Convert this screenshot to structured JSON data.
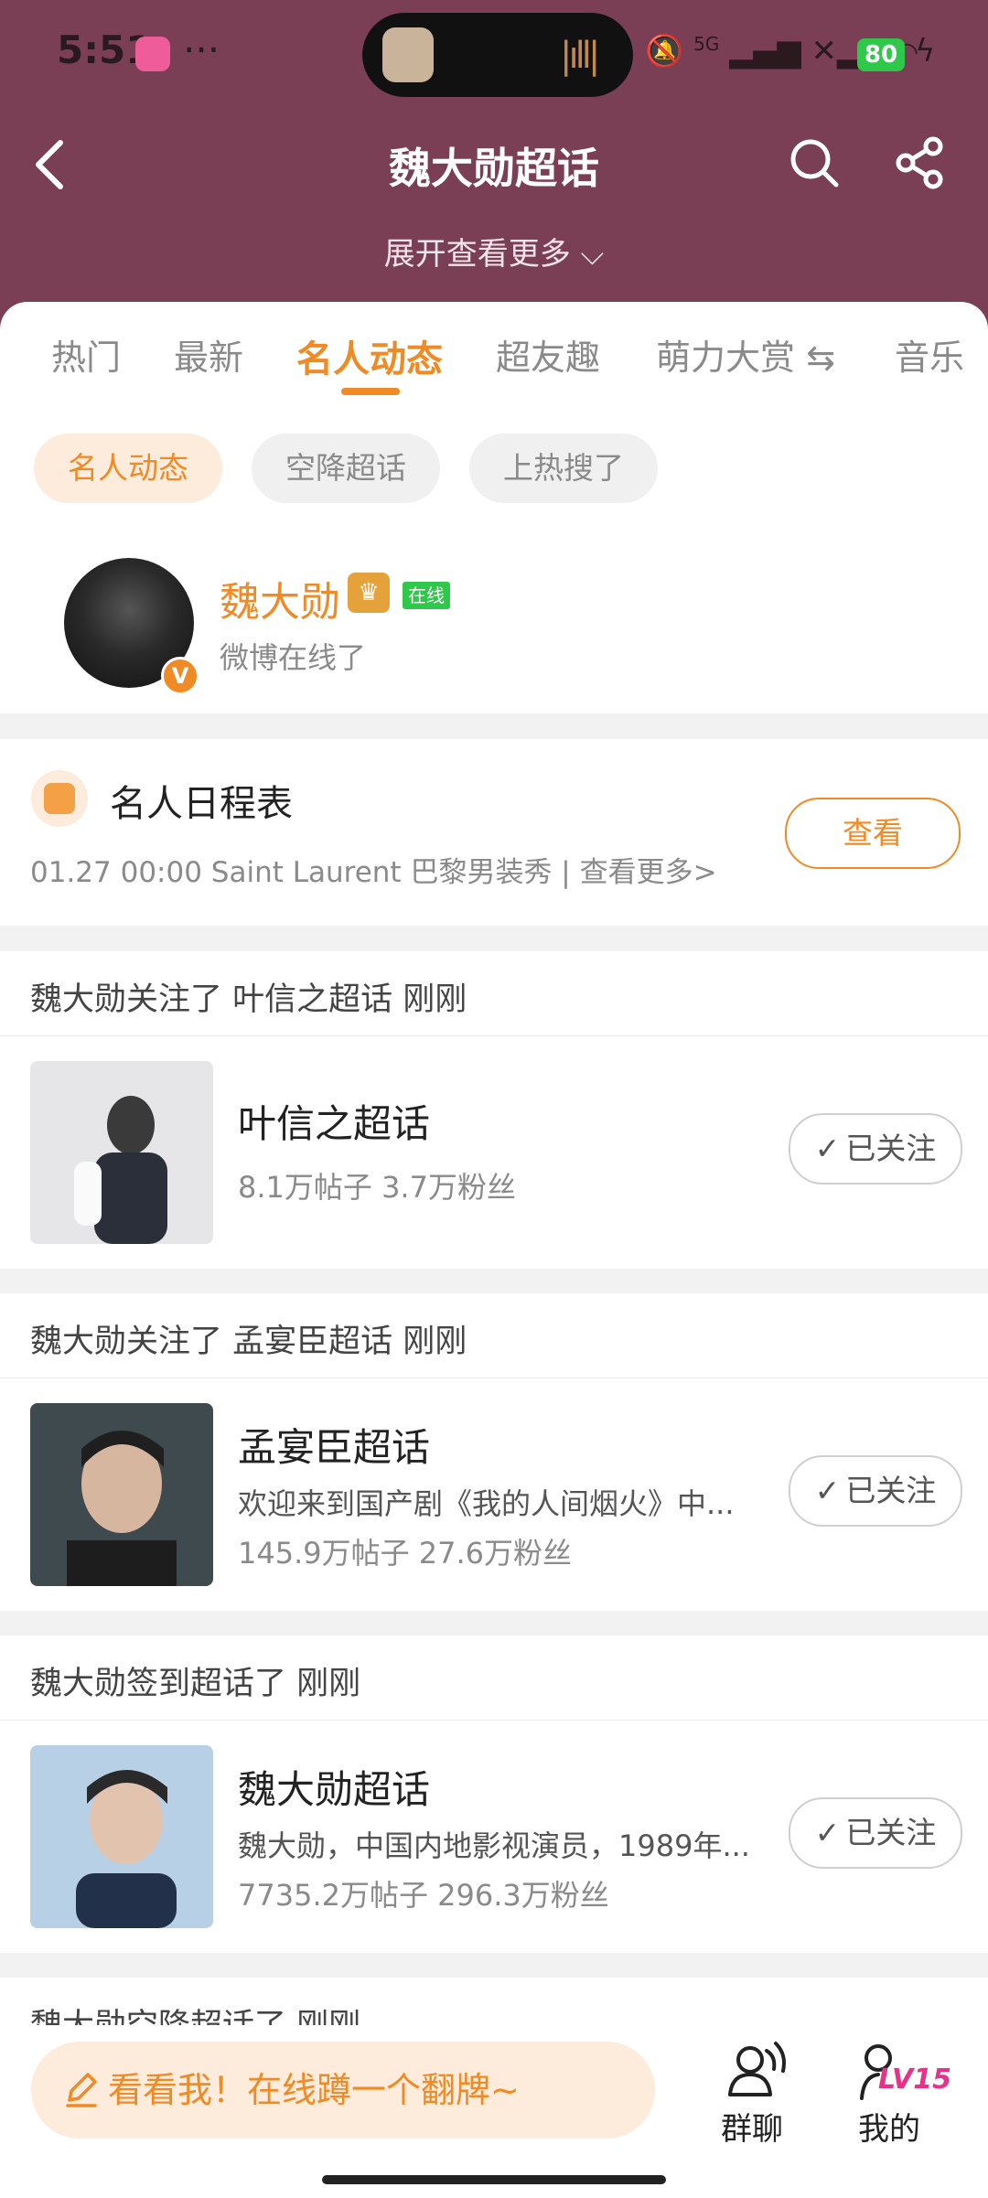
{
  "status_bar": {
    "time": "5:51",
    "dots": "···",
    "network": "5G",
    "battery": "80"
  },
  "header": {
    "title": "魏大勋超话",
    "expand_label": "展开查看更多 ⌵"
  },
  "tabs": [
    {
      "label": "热门",
      "active": false
    },
    {
      "label": "最新",
      "active": false
    },
    {
      "label": "名人动态",
      "active": true
    },
    {
      "label": "超友趣",
      "active": false
    },
    {
      "label": "萌力大赏 ⇆",
      "active": false
    },
    {
      "label": "音乐",
      "active": false
    }
  ],
  "chips": [
    {
      "label": "名人动态",
      "active": true
    },
    {
      "label": "空降超话",
      "active": false
    },
    {
      "label": "上热搜了",
      "active": false
    }
  ],
  "celebrity": {
    "name": "魏大勋",
    "badge": "在线",
    "status": "微博在线了",
    "verified": "V"
  },
  "schedule": {
    "title": "名人日程表",
    "detail": "01.27 00:00 Saint Laurent 巴黎男装秀 |  查看更多>",
    "button": "查看"
  },
  "activities": [
    {
      "header": "魏大勋关注了 叶信之超话 刚刚",
      "title": "叶信之超话",
      "desc": "",
      "stats": "8.1万帖子  3.7万粉丝",
      "follow_label": "已关注",
      "thumb_color": "#e9e9ea"
    },
    {
      "header": "魏大勋关注了 孟宴臣超话 刚刚",
      "title": "孟宴臣超话",
      "desc": "欢迎来到国产剧《我的人间烟火》中...",
      "stats": "145.9万帖子  27.6万粉丝",
      "follow_label": "已关注",
      "thumb_color": "#3e4a4f"
    },
    {
      "header": "魏大勋签到超话了 刚刚",
      "title": "魏大勋超话",
      "desc": "魏大勋，中国内地影视演员，1989年...",
      "stats": "7735.2万帖子  296.3万粉丝",
      "follow_label": "已关注",
      "thumb_color": "#b9d2ea"
    },
    {
      "header": "魏大勋空降超话了 刚刚"
    }
  ],
  "bottom_bar": {
    "input_placeholder": "看看我！在线蹲一个翻牌~",
    "group_label": "群聊",
    "me_label": "我的",
    "level": "LV15"
  },
  "colors": {
    "header_bg": "#7b3f55",
    "accent": "#f08a25",
    "online_green": "#2fc84b"
  }
}
